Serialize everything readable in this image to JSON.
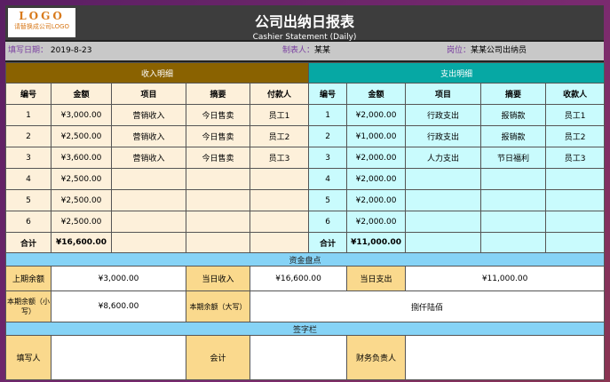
{
  "logo": {
    "text": "LOGO",
    "sub": "请替换成公司LOGO"
  },
  "title": {
    "main": "公司出纳日报表",
    "sub": "Cashier Statement (Daily)"
  },
  "info": {
    "date_label": "填写日期：",
    "date": "2019-8-23",
    "maker_label": "制表人：",
    "maker": "某某",
    "post_label": "岗位：",
    "post": "某某公司出纳员"
  },
  "income": {
    "title": "收入明细",
    "headers": [
      "编号",
      "金额",
      "项目",
      "摘要",
      "付款人"
    ],
    "rows": [
      [
        "1",
        "¥3,000.00",
        "营销收入",
        "今日售卖",
        "员工1"
      ],
      [
        "2",
        "¥2,500.00",
        "营销收入",
        "今日售卖",
        "员工2"
      ],
      [
        "3",
        "¥3,600.00",
        "营销收入",
        "今日售卖",
        "员工3"
      ],
      [
        "4",
        "¥2,500.00",
        "",
        "",
        ""
      ],
      [
        "5",
        "¥2,500.00",
        "",
        "",
        ""
      ],
      [
        "6",
        "¥2,500.00",
        "",
        "",
        ""
      ]
    ],
    "total_label": "合计",
    "total": "¥16,600.00"
  },
  "expense": {
    "title": "支出明细",
    "headers": [
      "编号",
      "金额",
      "项目",
      "摘要",
      "收款人"
    ],
    "rows": [
      [
        "1",
        "¥2,000.00",
        "行政支出",
        "报销款",
        "员工1"
      ],
      [
        "2",
        "¥1,000.00",
        "行政支出",
        "报销款",
        "员工2"
      ],
      [
        "3",
        "¥2,000.00",
        "人力支出",
        "节日福利",
        "员工3"
      ],
      [
        "4",
        "¥2,000.00",
        "",
        "",
        ""
      ],
      [
        "5",
        "¥2,000.00",
        "",
        "",
        ""
      ],
      [
        "6",
        "¥2,000.00",
        "",
        "",
        ""
      ]
    ],
    "total_label": "合计",
    "total": "¥11,000.00"
  },
  "fund": {
    "title": "资金盘点",
    "prev_label": "上期余额",
    "prev": "¥3,000.00",
    "in_label": "当日收入",
    "in": "¥16,600.00",
    "out_label": "当日支出",
    "out": "¥11,000.00",
    "bal_small_label": "本期余额（小写）",
    "bal_small": "¥8,600.00",
    "bal_big_label": "本期余额（大写）",
    "bal_big": "捌仟陆佰"
  },
  "sign": {
    "title": "签字栏",
    "filler": "填写人",
    "accountant": "会计",
    "manager": "财务负责人"
  }
}
